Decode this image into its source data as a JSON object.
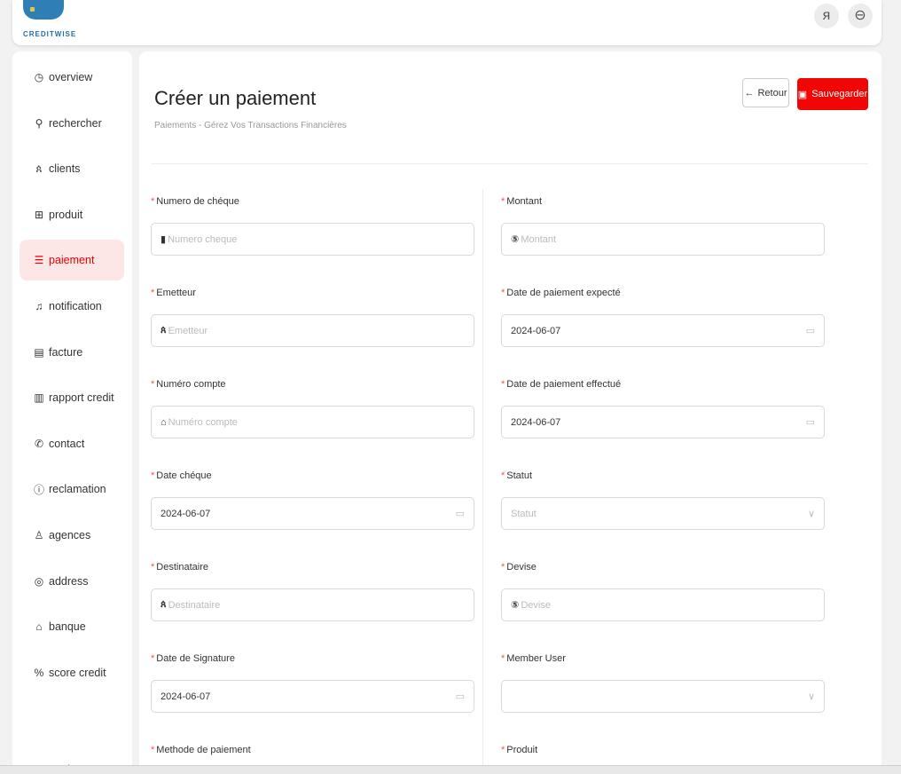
{
  "brand": {
    "name": "CREDITWISE",
    "color": "#1f6fa8"
  },
  "header": {
    "user_icon": "user-icon",
    "logout_icon": "logout-icon",
    "user_glyph": "ᴙ",
    "logout_glyph": "⊖"
  },
  "sidebar": {
    "items": [
      {
        "label": "overview",
        "icon": "dashboard-icon",
        "glyph": "◷"
      },
      {
        "label": "rechercher",
        "icon": "search-icon",
        "glyph": "⚲"
      },
      {
        "label": "clients",
        "icon": "users-icon",
        "glyph": "ጰ"
      },
      {
        "label": "produit",
        "icon": "product-icon",
        "glyph": "⊞"
      },
      {
        "label": "paiement",
        "icon": "payment-icon",
        "glyph": "☰"
      },
      {
        "label": "notification",
        "icon": "bell-icon",
        "glyph": "♫"
      },
      {
        "label": "facture",
        "icon": "invoice-icon",
        "glyph": "▤"
      },
      {
        "label": "rapport credit",
        "icon": "bar-chart-icon",
        "glyph": "▥"
      },
      {
        "label": "contact",
        "icon": "phone-icon",
        "glyph": "✆"
      },
      {
        "label": "reclamation",
        "icon": "alert-icon",
        "glyph": "ⓘ"
      },
      {
        "label": "agences",
        "icon": "network-icon",
        "glyph": "♙"
      },
      {
        "label": "address",
        "icon": "location-icon",
        "glyph": "◎"
      },
      {
        "label": "banque",
        "icon": "bank-icon",
        "glyph": "⌂"
      },
      {
        "label": "score credit",
        "icon": "percent-icon",
        "glyph": "%"
      }
    ],
    "active_index": 4,
    "active_color": "#e60000"
  },
  "page": {
    "title": "Créer un paiement",
    "subtitle": "Paiements - Gérez Vos Transactions Financières",
    "back_label": "Retour",
    "save_label": "Sauvegarder",
    "save_color": "#f20505"
  },
  "form": {
    "left": [
      {
        "label": "Numero de chéque",
        "placeholder": "Numero cheque",
        "value": "",
        "prefix_icon": "barcode-icon",
        "prefix": "▮",
        "suffix_icon": ""
      },
      {
        "label": "Emetteur",
        "placeholder": "Emetteur",
        "value": "",
        "prefix_icon": "user-icon",
        "prefix": "ጰ",
        "suffix_icon": ""
      },
      {
        "label": "Numéro compte",
        "placeholder": "Numéro compte",
        "value": "",
        "prefix_icon": "bank-icon",
        "prefix": "⌂",
        "suffix_icon": ""
      },
      {
        "label": "Date chéque",
        "placeholder": "",
        "value": "2024-06-07",
        "prefix_icon": "",
        "prefix": "",
        "suffix_icon": "calendar-icon"
      },
      {
        "label": "Destinataire",
        "placeholder": "Destinataire",
        "value": "",
        "prefix_icon": "user-icon",
        "prefix": "ጰ",
        "suffix_icon": ""
      },
      {
        "label": "Date de Signature",
        "placeholder": "",
        "value": "2024-06-07",
        "prefix_icon": "",
        "prefix": "",
        "suffix_icon": "calendar-icon"
      },
      {
        "label": "Methode de paiement",
        "placeholder": "",
        "value": "",
        "prefix_icon": "",
        "prefix": "",
        "suffix_icon": ""
      }
    ],
    "right": [
      {
        "label": "Montant",
        "placeholder": "Montant",
        "value": "",
        "prefix_icon": "dollar-icon",
        "prefix": "⑤",
        "suffix_icon": ""
      },
      {
        "label": "Date de paiement expecté",
        "placeholder": "",
        "value": "2024-06-07",
        "prefix_icon": "",
        "prefix": "",
        "suffix_icon": "calendar-icon"
      },
      {
        "label": "Date de paiement effectué",
        "placeholder": "",
        "value": "2024-06-07",
        "prefix_icon": "",
        "prefix": "",
        "suffix_icon": "calendar-icon"
      },
      {
        "label": "Statut",
        "placeholder": "Statut",
        "value": "",
        "prefix_icon": "",
        "prefix": "",
        "suffix_icon": "chevron-down-icon"
      },
      {
        "label": "Devise",
        "placeholder": "Devise",
        "value": "",
        "prefix_icon": "dollar-icon",
        "prefix": "⑤",
        "suffix_icon": ""
      },
      {
        "label": "Member User",
        "placeholder": "",
        "value": "",
        "prefix_icon": "",
        "prefix": "",
        "suffix_icon": "chevron-down-icon"
      },
      {
        "label": "Produit",
        "placeholder": "",
        "value": "",
        "prefix_icon": "",
        "prefix": "",
        "suffix_icon": ""
      }
    ],
    "required_mark": "*",
    "required_color": "#ff4d4f"
  }
}
